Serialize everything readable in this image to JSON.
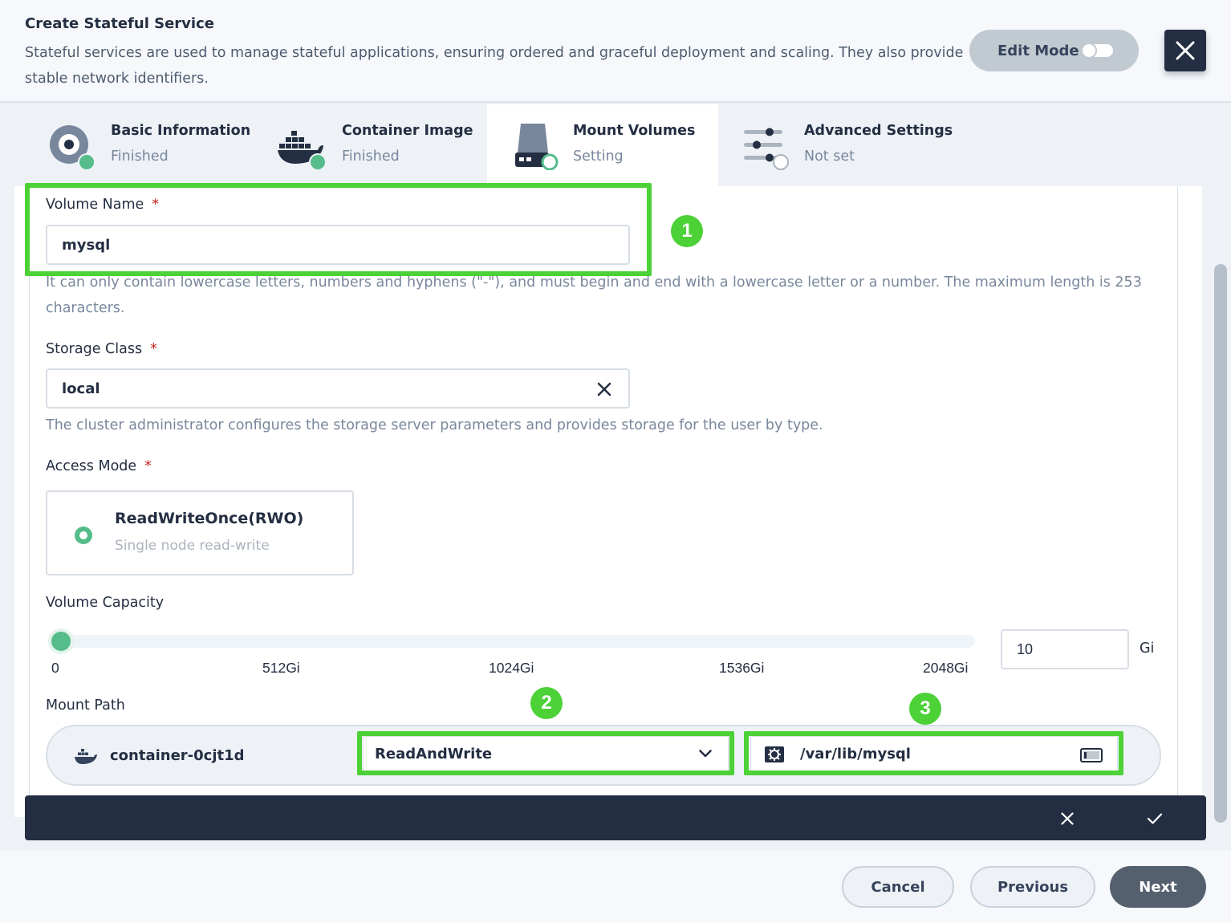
{
  "header": {
    "title": "Create Stateful Service",
    "description": "Stateful services are used to manage stateful applications, ensuring ordered and graceful deployment and scaling. They also provide stable network identifiers.",
    "edit_mode_label": "Edit Mode"
  },
  "steps": [
    {
      "name": "Basic Information",
      "status": "Finished",
      "state": "done"
    },
    {
      "name": "Container Image",
      "status": "Finished",
      "state": "done"
    },
    {
      "name": "Mount Volumes",
      "status": "Setting",
      "state": "active"
    },
    {
      "name": "Advanced Settings",
      "status": "Not set",
      "state": "pending"
    }
  ],
  "form": {
    "volume_name": {
      "label": "Volume Name",
      "required_mark": "*",
      "value": "mysql",
      "hint": "It can only contain lowercase letters, numbers and hyphens (\"-\"), and must begin and end with a lowercase letter or a number. The maximum length is 253 characters."
    },
    "storage_class": {
      "label": "Storage Class",
      "required_mark": "*",
      "value": "local",
      "hint": "The cluster administrator configures the storage server parameters and provides storage for the user by type."
    },
    "access_mode": {
      "label": "Access Mode",
      "required_mark": "*",
      "option_title": "ReadWriteOnce(RWO)",
      "option_desc": "Single node read-write"
    },
    "capacity": {
      "label": "Volume Capacity",
      "ticks": [
        "0",
        "512Gi",
        "1024Gi",
        "1536Gi",
        "2048Gi"
      ],
      "value": "10",
      "unit": "Gi",
      "slider_min": 0,
      "slider_max": 2048,
      "slider_value": 10
    },
    "mount_path": {
      "label": "Mount Path",
      "container": "container-0cjt1d",
      "mode": "ReadAndWrite",
      "path": "/var/lib/mysql"
    }
  },
  "annotations": [
    "1",
    "2",
    "3"
  ],
  "colors": {
    "highlight": "#4cd137",
    "accent_green": "#55bc8a",
    "dark": "#242e42"
  },
  "footer": {
    "cancel": "Cancel",
    "previous": "Previous",
    "next": "Next"
  }
}
